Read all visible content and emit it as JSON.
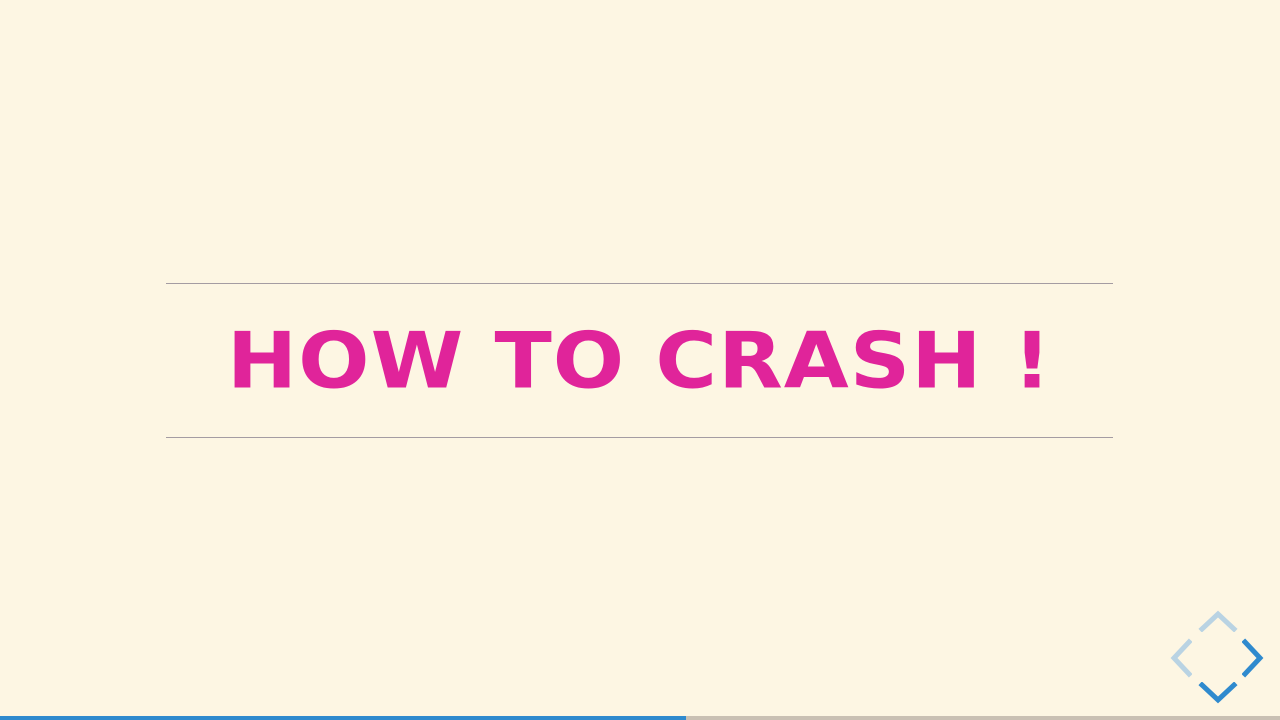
{
  "slide": {
    "title": "HOW TO CRASH !"
  },
  "navigation": {
    "up_enabled": false,
    "left_enabled": false,
    "right_enabled": true,
    "down_enabled": true,
    "enabled_color": "#2f8ace",
    "disabled_color": "#b9d3e3",
    "icons": [
      "chevron-up-icon",
      "chevron-left-icon",
      "chevron-right-icon",
      "chevron-down-icon"
    ]
  },
  "progress": {
    "fraction": 0.536,
    "fill_color": "#2f8ace",
    "track_color": "#c9c0b3"
  },
  "theme": {
    "background": "#fdf6e3",
    "title_color": "#e0249a",
    "rule_color": "#a49ca2"
  }
}
